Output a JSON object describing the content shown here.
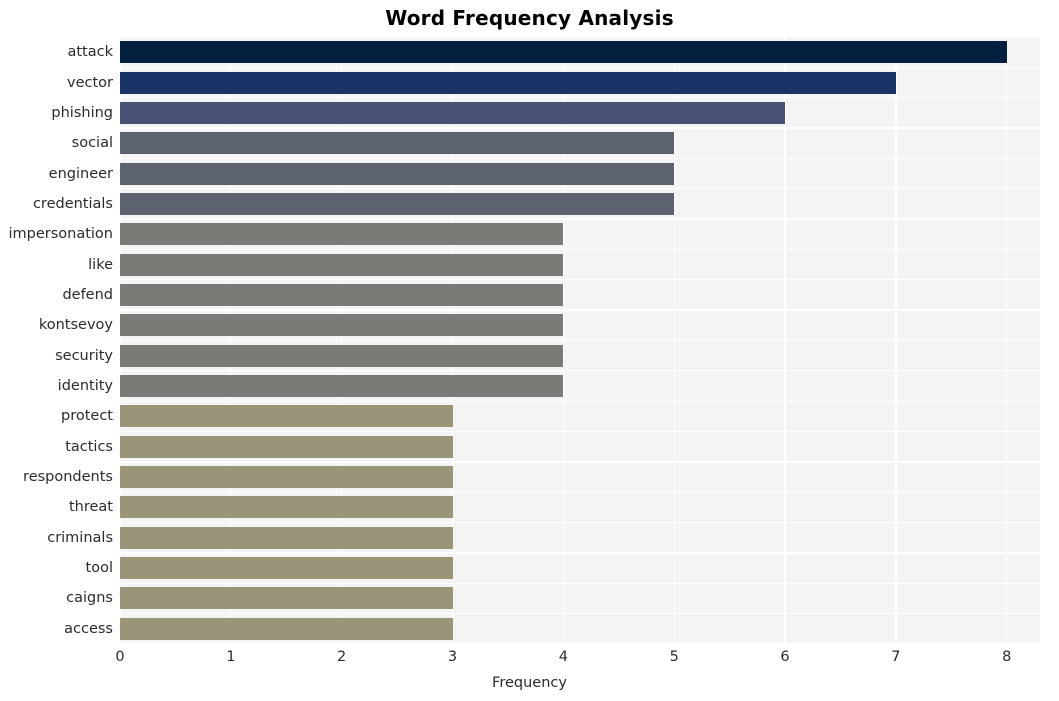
{
  "chart_data": {
    "type": "bar",
    "orientation": "horizontal",
    "title": "Word Frequency Analysis",
    "xlabel": "Frequency",
    "ylabel": "",
    "xlim": [
      0,
      8.3
    ],
    "xticks": [
      "0",
      "1",
      "2",
      "3",
      "4",
      "5",
      "6",
      "7",
      "8"
    ],
    "xtick_values": [
      0,
      1,
      2,
      3,
      4,
      5,
      6,
      7,
      8
    ],
    "grid": true,
    "legend": null,
    "categories": [
      "attack",
      "vector",
      "phishing",
      "social",
      "engineer",
      "credentials",
      "impersonation",
      "like",
      "defend",
      "kontsevoy",
      "security",
      "identity",
      "protect",
      "tactics",
      "respondents",
      "threat",
      "criminals",
      "tool",
      "caigns",
      "access"
    ],
    "values": [
      8,
      7,
      6,
      5,
      5,
      5,
      4,
      4,
      4,
      4,
      4,
      4,
      3,
      3,
      3,
      3,
      3,
      3,
      3,
      3
    ],
    "bar_colors": [
      "#04203F",
      "#1B3468",
      "#475173",
      "#5D6270",
      "#5D6270",
      "#5D6270",
      "#7A7A76",
      "#7A7A76",
      "#7A7A76",
      "#7A7A76",
      "#7A7A76",
      "#7A7A76",
      "#9A9578",
      "#9A9578",
      "#9A9578",
      "#9A9578",
      "#9A9578",
      "#9A9578",
      "#9A9578",
      "#9A9578"
    ],
    "plot_background": "#F4F4F5",
    "grid_color": "#FFFFFF",
    "figure_background": "#FFFFFF",
    "text_color": "#2b2b2b"
  }
}
